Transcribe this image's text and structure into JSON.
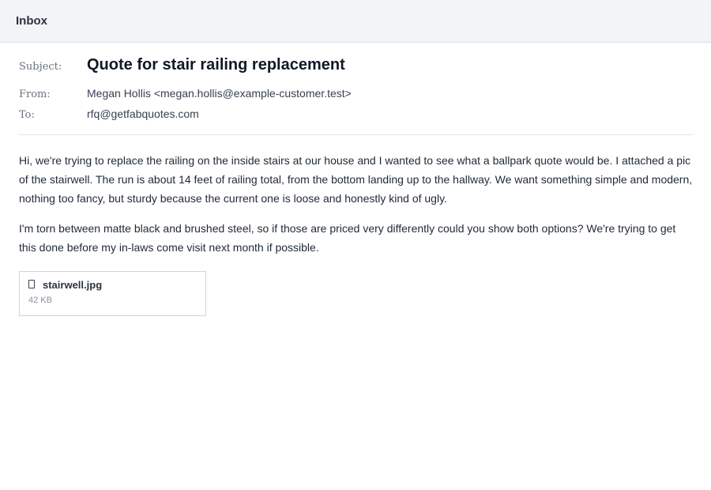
{
  "topbar": {
    "title": "Inbox"
  },
  "message": {
    "subject_label": "Subject:",
    "subject": "Quote for stair railing replacement",
    "from_label": "From:",
    "from": "Megan Hollis <megan.hollis@example-customer.test>",
    "to_label": "To:",
    "to": "rfq@getfabquotes.com",
    "body": [
      "Hi, we're trying to replace the railing on the inside stairs at our house and I wanted to see what a ballpark quote would be. I attached a pic of the stairwell. The run is about 14 feet of railing total, from the bottom landing up to the hallway. We want something simple and modern, nothing too fancy, but sturdy because the current one is loose and honestly kind of ugly.",
      "I'm torn between matte black and brushed steel, so if those are priced very differently could you show both options? We're trying to get this done before my in-laws come visit next month if possible."
    ],
    "attachment": {
      "name": "stairwell.jpg",
      "size": "42 KB",
      "icon": "file-icon"
    }
  }
}
